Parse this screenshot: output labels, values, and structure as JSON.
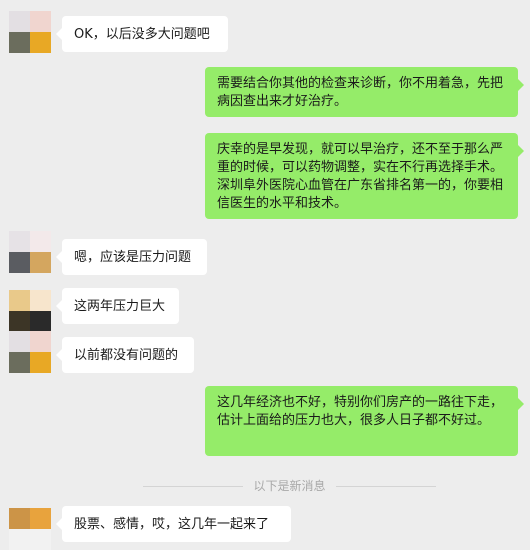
{
  "messages": [
    {
      "side": "left",
      "text": "OK，以后没多大问题吧",
      "avatar_colors": [
        "#e3dfe3",
        "#f0d5cf",
        "#6b6d5d",
        "#e8a825"
      ]
    },
    {
      "side": "right",
      "text": "需要结合你其他的检查来诊断，你不用着急，先把病因查出来才好治疗。"
    },
    {
      "side": "right",
      "text": "庆幸的是早发现，就可以早治疗，还不至于那么严重的时候，可以药物调整，实在不行再选择手术。深圳阜外医院心血管在广东省排名第一的，你要相信医生的水平和技术。"
    },
    {
      "side": "left",
      "text": "嗯，应该是压力问题",
      "avatar_colors": [
        "#e6e2e6",
        "#f3e9ea",
        "#5a5c61",
        "#d4a65f"
      ]
    },
    {
      "side": "left",
      "text": "这两年压力巨大",
      "avatar_colors": [
        "#e9c98a",
        "#f7e5cc",
        "#3c3526",
        "#2a2a2a"
      ]
    },
    {
      "side": "left",
      "text": "以前都没有问题的",
      "avatar_colors": [
        "#e3dfe3",
        "#f0d5cf",
        "#6b6d5d",
        "#e8a825"
      ]
    },
    {
      "side": "right",
      "text": "这几年经济也不好，特别你们房产的一路往下走，估计上面给的压力也大，很多人日子都不好过。"
    },
    {
      "side": "left",
      "text": "股票、感情，哎，这几年一起来了",
      "avatar_colors": [
        "#cc9447",
        "#e8a33d",
        "#f2f2f2",
        "#f2f2f2"
      ]
    }
  ],
  "divider_text": "以下是新消息"
}
